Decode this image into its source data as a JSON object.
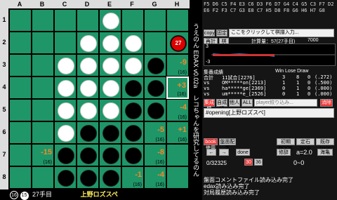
{
  "board": {
    "columns": [
      "A",
      "B",
      "C",
      "D",
      "E",
      "F",
      "G",
      "H"
    ],
    "rows": [
      "1",
      "2",
      "3",
      "4",
      "5",
      "6",
      "7",
      "8"
    ],
    "cells": [
      [
        "e",
        "e",
        "e",
        "e",
        "w",
        "e",
        "e",
        "e"
      ],
      [
        "e",
        "e",
        "e",
        "w",
        "w",
        "w",
        "e",
        "b27"
      ],
      [
        "e",
        "e",
        "w",
        "w",
        "w",
        "w",
        "b",
        "hint:-9:(16)"
      ],
      [
        "e",
        "e",
        "w",
        "w",
        "w",
        "b",
        "b",
        "hint:+3:(16)"
      ],
      [
        "e",
        "e",
        "w",
        "w",
        "w",
        "b",
        "b",
        "hint:-4:(16)"
      ],
      [
        "e",
        "e",
        "w",
        "b",
        "b",
        "b",
        "hint:-5:(16)",
        "hint:+1:(16)"
      ],
      [
        "e",
        "hint:-15:(16)",
        "b",
        "b",
        "b",
        "b",
        "hint:-8:(16)",
        "e"
      ],
      [
        "e",
        "e",
        "b",
        "b",
        "b",
        "hint:-1:(16)",
        "hint:-4:(16)",
        "e"
      ]
    ],
    "selected": "H4",
    "badge_27": "27"
  },
  "status": {
    "black_count": "16",
    "white_count": "15",
    "move_label": "27手目",
    "opening": "上野ロズスペ"
  },
  "vertical": {
    "title": "うえのん EDAX v0.02a",
    "subtitle": "レコちゃんを研究してるのん"
  },
  "panel": {
    "move_list": "F5 D6 C5 F4 E3 C6 D3 F6 D7 G4 C4 G5 C3 F7 D2 E6 F2 F3 C7 G3 E8 C7 H5 D8 F8 G6 H6 H7 G8",
    "buttons": {
      "copy": "copy",
      "fix": "固定",
      "click_label": "ここをクリックして棋譜入力...",
      "keisan": "再計算",
      "kifu": "棋譜",
      "book": "book使用",
      "board_setting": "盤面配置",
      "back": "←",
      "forward": "→",
      "done": "done",
      "book_btn1": "初期BOOK",
      "book_btn2": "定石book",
      "book_btn3": "既存book",
      "hint_setting": "修辞",
      "sea": "海亀"
    },
    "calc_label": "計算量：57(27手目)",
    "calc_value": "7000",
    "graph_labels": {
      "top": "3",
      "bottom": "-3"
    },
    "stats_title": "集番成績",
    "stats_header": "Win  Lose Draw",
    "stats": [
      {
        "name": "合計",
        "detail": "11試合[2276]",
        "win": "3",
        "lose": "8",
        "draw": "0",
        "rate": "(.272)"
      },
      {
        "name": "vs",
        "detail": "OM*****on[2213]",
        "win": "1",
        "lose": "1",
        "draw": "0",
        "rate": "(.500)"
      },
      {
        "name": "vs",
        "detail": "ha*****ge[2369]",
        "win": "0",
        "lose": "1",
        "draw": "0",
        "rate": "(.000)"
      },
      {
        "name": "vs",
        "detail": "um*****e_[2526]",
        "win": "0",
        "lose": "1",
        "draw": "0",
        "rate": "(.000)"
      }
    ],
    "filter_btns": [
      "集成績",
      "自成績",
      "他人",
      "ALL"
    ],
    "player_placeholder": "player絞り込み...",
    "reset": "消除",
    "opening_input": "#opening[上野ロズスペ]",
    "counter": "0/32325",
    "alpha": "a=2.0",
    "level1": "30",
    "level2": "36",
    "range": "0~0",
    "log": [
      "盤面コメントファイル読み込み完了",
      "edax読み込み完了",
      "対局履歴読み込み完了"
    ]
  }
}
